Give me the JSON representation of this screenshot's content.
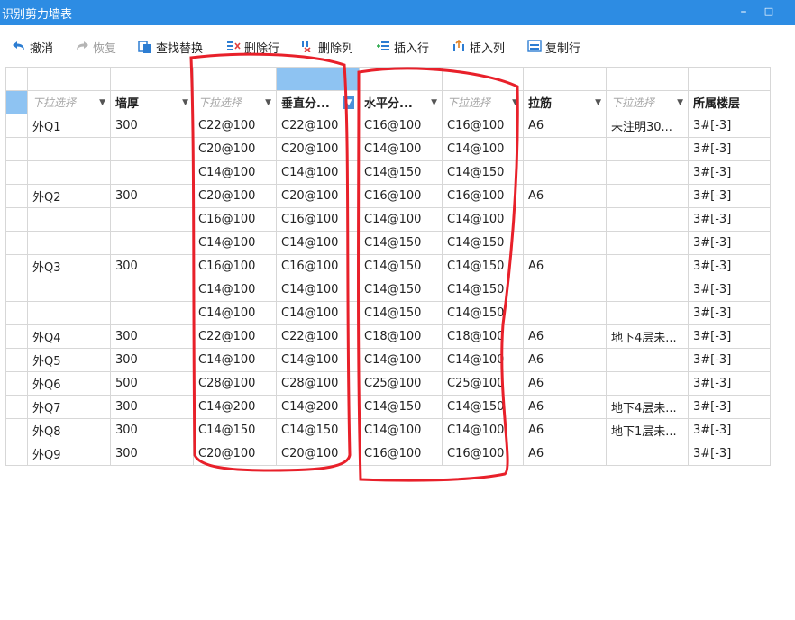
{
  "window": {
    "title": "识别剪力墙表",
    "minimize_glyph": "–",
    "maximize_glyph": "□"
  },
  "toolbar": {
    "undo": {
      "label": "撤消",
      "icon": "undo-arrow-icon"
    },
    "redo": {
      "label": "恢复",
      "icon": "redo-arrow-icon"
    },
    "find_replace": {
      "label": "查找替换",
      "icon": "find-replace-icon"
    },
    "delete_row": {
      "label": "删除行",
      "icon": "delete-row-icon"
    },
    "delete_col": {
      "label": "删除列",
      "icon": "delete-column-icon"
    },
    "insert_row": {
      "label": "插入行",
      "icon": "insert-row-icon"
    },
    "insert_col": {
      "label": "插入列",
      "icon": "insert-column-icon"
    },
    "copy_row": {
      "label": "复制行",
      "icon": "copy-row-icon"
    }
  },
  "grid": {
    "field_headers": [
      {
        "text": "下拉选择",
        "placeholder": true
      },
      {
        "text": "墙厚",
        "placeholder": false
      },
      {
        "text": "下拉选择",
        "placeholder": true
      },
      {
        "text": "垂直分...",
        "placeholder": false
      },
      {
        "text": "水平分...",
        "placeholder": false
      },
      {
        "text": "下拉选择",
        "placeholder": true
      },
      {
        "text": "拉筋",
        "placeholder": false
      },
      {
        "text": "下拉选择",
        "placeholder": true
      },
      {
        "text": "所属楼层",
        "placeholder": false
      }
    ],
    "rows": [
      [
        "外Q1",
        "300",
        "C22@100",
        "C22@100",
        "C16@100",
        "C16@100",
        "A6",
        "未注明30...",
        "3#[-3]"
      ],
      [
        "",
        "",
        "C20@100",
        "C20@100",
        "C14@100",
        "C14@100",
        "",
        "",
        "3#[-3]"
      ],
      [
        "",
        "",
        "C14@100",
        "C14@100",
        "C14@150",
        "C14@150",
        "",
        "",
        "3#[-3]"
      ],
      [
        "外Q2",
        "300",
        "C20@100",
        "C20@100",
        "C16@100",
        "C16@100",
        "A6",
        "",
        "3#[-3]"
      ],
      [
        "",
        "",
        "C16@100",
        "C16@100",
        "C14@100",
        "C14@100",
        "",
        "",
        "3#[-3]"
      ],
      [
        "",
        "",
        "C14@100",
        "C14@100",
        "C14@150",
        "C14@150",
        "",
        "",
        "3#[-3]"
      ],
      [
        "外Q3",
        "300",
        "C16@100",
        "C16@100",
        "C14@150",
        "C14@150",
        "A6",
        "",
        "3#[-3]"
      ],
      [
        "",
        "",
        "C14@100",
        "C14@100",
        "C14@150",
        "C14@150",
        "",
        "",
        "3#[-3]"
      ],
      [
        "",
        "",
        "C14@100",
        "C14@100",
        "C14@150",
        "C14@150",
        "",
        "",
        "3#[-3]"
      ],
      [
        "外Q4",
        "300",
        "C22@100",
        "C22@100",
        "C18@100",
        "C18@100",
        "A6",
        "地下4层未...",
        "3#[-3]"
      ],
      [
        "外Q5",
        "300",
        "C14@100",
        "C14@100",
        "C14@100",
        "C14@100",
        "A6",
        "",
        "3#[-3]"
      ],
      [
        "外Q6",
        "500",
        "C28@100",
        "C28@100",
        "C25@100",
        "C25@100",
        "A6",
        "",
        "3#[-3]"
      ],
      [
        "外Q7",
        "300",
        "C14@200",
        "C14@200",
        "C14@150",
        "C14@150",
        "A6",
        "地下4层未...",
        "3#[-3]"
      ],
      [
        "外Q8",
        "300",
        "C14@150",
        "C14@150",
        "C14@100",
        "C14@100",
        "A6",
        "地下1层未...",
        "3#[-3]"
      ],
      [
        "外Q9",
        "300",
        "C20@100",
        "C20@100",
        "C16@100",
        "C16@100",
        "A6",
        "",
        "3#[-3]"
      ]
    ]
  },
  "colors": {
    "titlebar": "#2d8ce3",
    "selected_column": "#8ec3f2",
    "annotation": "#e8202a"
  }
}
